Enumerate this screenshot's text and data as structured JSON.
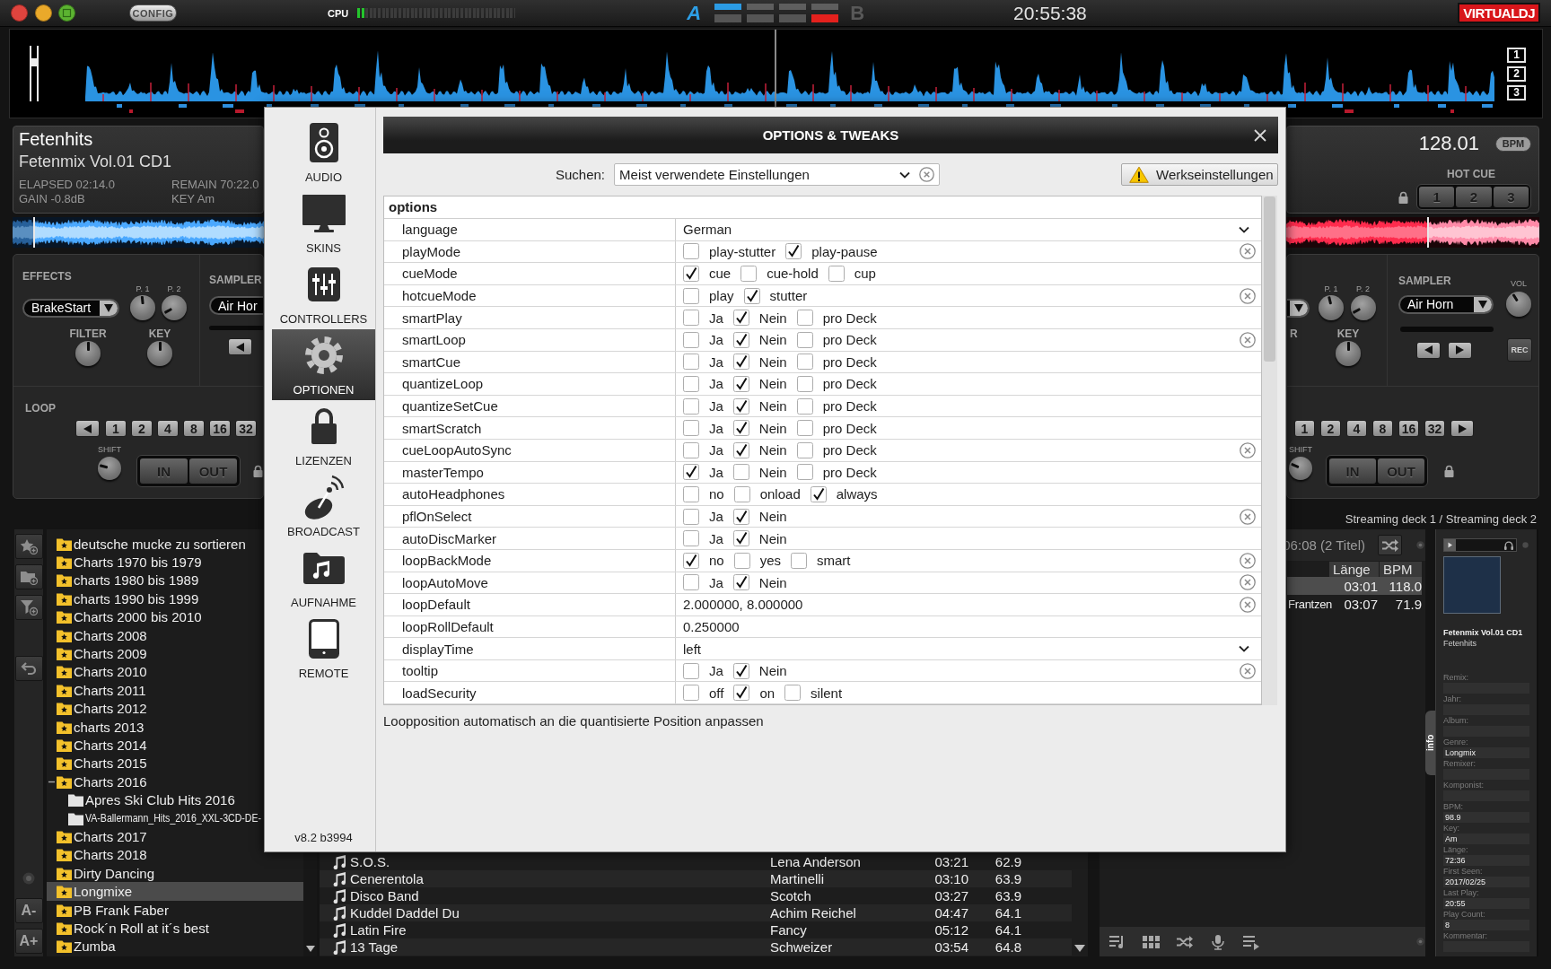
{
  "top_bar": {
    "config": "CONFIG",
    "cpu": {
      "label": "CPU",
      "level": 0.05
    },
    "deck_a": "A",
    "deck_slots": [
      {
        "top_on": true,
        "bottom_on": false,
        "color": "#2b9be4"
      },
      {
        "top_on": false,
        "bottom_on": false
      },
      {
        "top_on": false,
        "bottom_on": false
      },
      {
        "top_on": false,
        "bottom_on": true,
        "color": "#e3211d"
      }
    ],
    "deck_b": "B",
    "clock": "20:55:38",
    "logo": "VIRTUALDJ"
  },
  "overview": {
    "zoom_buttons": [
      "1",
      "2",
      "3"
    ]
  },
  "left_deck": {
    "title": "Fetenhits",
    "album": "Fetenmix Vol.01 CD1",
    "elapsed": "ELAPSED 02:14.0",
    "remain": "REMAIN 70:22.0",
    "gain": "GAIN -0.8dB",
    "key": "KEY Am",
    "effects": {
      "label": "EFFECTS",
      "effect": "BrakeStart",
      "knobs": [
        {
          "label": "P. 1",
          "level": 0.48
        },
        {
          "label": "P. 2",
          "level": 0.06
        }
      ]
    },
    "filter": {
      "label": "FILTER",
      "level": 0.5
    },
    "key_knob": {
      "label": "KEY",
      "level": 0.5
    },
    "sampler": {
      "label": "SAMPLER",
      "sample": "Air Hor"
    },
    "loop": {
      "label": "LOOP",
      "sizes": [
        "1",
        "2",
        "4",
        "8",
        "16",
        "32"
      ],
      "shift": {
        "label": "SHIFT",
        "level": 0.22
      },
      "in": "IN",
      "out": "OUT"
    }
  },
  "right_deck": {
    "bpm": "128.01",
    "bpm_unit": "BPM",
    "hot_cue": {
      "label": "HOT CUE",
      "buttons": [
        "1",
        "2",
        "3"
      ]
    },
    "effects": {
      "knobs": [
        {
          "label": "P. 1",
          "level": 0.45
        },
        {
          "label": "P. 2",
          "level": 0.06
        }
      ]
    },
    "filter": {
      "label": "R"
    },
    "key_knob": {
      "label": "KEY",
      "level": 0.5
    },
    "sampler": {
      "label": "SAMPLER",
      "sample": "Air Horn",
      "volume": {
        "label": "VOL",
        "level": 0.38
      },
      "rec": "REC"
    },
    "loop": {
      "sizes": [
        "1",
        "2",
        "4",
        "8",
        "16",
        "32"
      ],
      "shift": {
        "label": "SHIFT",
        "level": 0.25
      },
      "in": "IN",
      "out": "OUT"
    }
  },
  "streaming": "Streaming deck 1 / Streaming deck 2",
  "browser": {
    "toolbar": [
      "A-",
      "A+"
    ],
    "folders": [
      {
        "name": "deutsche mucke zu sortieren",
        "kind": "favorite",
        "selected": false
      },
      {
        "name": "Charts 1970 bis 1979",
        "kind": "favorite",
        "selected": false
      },
      {
        "name": "charts 1980 bis 1989",
        "kind": "favorite",
        "selected": false
      },
      {
        "name": "charts 1990 bis 1999",
        "kind": "favorite",
        "selected": false
      },
      {
        "name": "Charts 2000 bis 2010",
        "kind": "favorite",
        "selected": false
      },
      {
        "name": "Charts 2008",
        "kind": "favorite",
        "selected": false
      },
      {
        "name": "Charts 2009",
        "kind": "favorite",
        "selected": false
      },
      {
        "name": "Charts 2010",
        "kind": "favorite",
        "selected": false
      },
      {
        "name": "Charts 2011",
        "kind": "favorite",
        "selected": false
      },
      {
        "name": "Charts 2012",
        "kind": "favorite",
        "selected": false
      },
      {
        "name": "charts 2013",
        "kind": "favorite",
        "selected": false
      },
      {
        "name": "Charts 2014",
        "kind": "favorite",
        "selected": false
      },
      {
        "name": "Charts 2015",
        "kind": "favorite",
        "selected": false
      },
      {
        "name": "Charts 2016",
        "kind": "favorite",
        "selected": false,
        "expanded": true,
        "children": [
          {
            "name": "Apres Ski Club Hits 2016",
            "kind": "folder",
            "selected": false
          },
          {
            "name": "VA-Ballermann_Hits_2016_XXL-3CD-DE-",
            "kind": "folder",
            "selected": false
          }
        ]
      },
      {
        "name": "Charts 2017",
        "kind": "favorite",
        "selected": false
      },
      {
        "name": "Charts 2018",
        "kind": "favorite",
        "selected": false
      },
      {
        "name": "Dirty Dancing",
        "kind": "favorite",
        "selected": false
      },
      {
        "name": "Longmixe",
        "kind": "favorite",
        "selected": true
      },
      {
        "name": "PB Frank Faber",
        "kind": "favorite",
        "selected": false
      },
      {
        "name": "Rock´n Roll at it´s best",
        "kind": "favorite",
        "selected": false
      },
      {
        "name": "Zumba",
        "kind": "favorite",
        "selected": false
      }
    ],
    "tracks": [
      {
        "title": "S.O.S.",
        "artist": "Lena Anderson",
        "length": "03:21",
        "bpm": "62.9"
      },
      {
        "title": "Cenerentola",
        "artist": "Martinelli",
        "length": "03:10",
        "bpm": "63.9"
      },
      {
        "title": "Disco Band",
        "artist": "Scotch",
        "length": "03:27",
        "bpm": "63.9"
      },
      {
        "title": "Kuddel Daddel Du",
        "artist": "Achim Reichel",
        "length": "04:47",
        "bpm": "64.1"
      },
      {
        "title": "Latin Fire",
        "artist": "Fancy",
        "length": "05:12",
        "bpm": "64.1"
      },
      {
        "title": "13 Tage",
        "artist": "Schweizer",
        "length": "03:54",
        "bpm": "64.8"
      }
    ],
    "sideview": {
      "summary": "06:08 (2 Titel)",
      "columns": [
        "Länge",
        "BPM"
      ],
      "rows": [
        {
          "length": "03:01",
          "bpm": "118.0",
          "selected": true
        },
        {
          "artist": "Frantzen",
          "length": "03:07",
          "bpm": "71.9",
          "selected": false
        }
      ]
    },
    "info": {
      "tab": "info",
      "title": "Fetenmix Vol.01 CD1",
      "artist": "Fetenhits",
      "fields": [
        {
          "label": "Remix:"
        },
        {
          "label": "Jahr:"
        },
        {
          "label": "Album:"
        },
        {
          "label": "Genre:",
          "value": "Longmix"
        },
        {
          "label": "Remixer:"
        },
        {
          "label": "Komponist:"
        },
        {
          "label": "BPM:",
          "value": "98.9"
        },
        {
          "label": "Key:",
          "value": "Am"
        },
        {
          "label": "Länge:",
          "value": "72:36"
        },
        {
          "label": "First Seen:",
          "value": "2017/02/25"
        },
        {
          "label": "Last Play:",
          "value": "20:55"
        },
        {
          "label": "Play Count:",
          "value": "8"
        },
        {
          "label": "Kommentar:"
        }
      ]
    }
  },
  "dialog": {
    "title": "OPTIONS & TWEAKS",
    "sidebar": [
      {
        "label": "AUDIO",
        "selected": false
      },
      {
        "label": "SKINS",
        "selected": false
      },
      {
        "label": "CONTROLLERS",
        "selected": false
      },
      {
        "label": "OPTIONEN",
        "selected": true
      },
      {
        "label": "LIZENZEN",
        "selected": false
      },
      {
        "label": "BROADCAST",
        "selected": false
      },
      {
        "label": "AUFNAHME",
        "selected": false
      },
      {
        "label": "REMOTE",
        "selected": false
      }
    ],
    "version": "v8.2 b3994",
    "search": {
      "label": "Suchen:",
      "value": "Meist verwendete Einstellungen"
    },
    "factory_reset": "Werkseinstellungen",
    "table": {
      "section": "options",
      "rows": [
        {
          "name": "language",
          "kind": "dropdown",
          "value": "German",
          "modified": false
        },
        {
          "name": "playMode",
          "kind": "checks",
          "options": [
            {
              "label": "play-stutter",
              "checked": false
            },
            {
              "label": "play-pause",
              "checked": true
            }
          ],
          "modified": true
        },
        {
          "name": "cueMode",
          "kind": "checks",
          "options": [
            {
              "label": "cue",
              "checked": true
            },
            {
              "label": "cue-hold",
              "checked": false
            },
            {
              "label": "cup",
              "checked": false
            }
          ],
          "modified": false
        },
        {
          "name": "hotcueMode",
          "kind": "checks",
          "options": [
            {
              "label": "play",
              "checked": false
            },
            {
              "label": "stutter",
              "checked": true
            }
          ],
          "modified": true
        },
        {
          "name": "smartPlay",
          "kind": "checks",
          "options": [
            {
              "label": "Ja",
              "checked": false
            },
            {
              "label": "Nein",
              "checked": true
            },
            {
              "label": "pro Deck",
              "checked": false
            }
          ],
          "modified": false
        },
        {
          "name": "smartLoop",
          "kind": "checks",
          "options": [
            {
              "label": "Ja",
              "checked": false
            },
            {
              "label": "Nein",
              "checked": true
            },
            {
              "label": "pro Deck",
              "checked": false
            }
          ],
          "modified": true
        },
        {
          "name": "smartCue",
          "kind": "checks",
          "options": [
            {
              "label": "Ja",
              "checked": false
            },
            {
              "label": "Nein",
              "checked": true
            },
            {
              "label": "pro Deck",
              "checked": false
            }
          ],
          "modified": false
        },
        {
          "name": "quantizeLoop",
          "kind": "checks",
          "options": [
            {
              "label": "Ja",
              "checked": false
            },
            {
              "label": "Nein",
              "checked": true
            },
            {
              "label": "pro Deck",
              "checked": false
            }
          ],
          "modified": false
        },
        {
          "name": "quantizeSetCue",
          "kind": "checks",
          "options": [
            {
              "label": "Ja",
              "checked": false
            },
            {
              "label": "Nein",
              "checked": true
            },
            {
              "label": "pro Deck",
              "checked": false
            }
          ],
          "modified": false
        },
        {
          "name": "smartScratch",
          "kind": "checks",
          "options": [
            {
              "label": "Ja",
              "checked": false
            },
            {
              "label": "Nein",
              "checked": true
            },
            {
              "label": "pro Deck",
              "checked": false
            }
          ],
          "modified": false
        },
        {
          "name": "cueLoopAutoSync",
          "kind": "checks",
          "options": [
            {
              "label": "Ja",
              "checked": false
            },
            {
              "label": "Nein",
              "checked": true
            },
            {
              "label": "pro Deck",
              "checked": false
            }
          ],
          "modified": true
        },
        {
          "name": "masterTempo",
          "kind": "checks",
          "options": [
            {
              "label": "Ja",
              "checked": true
            },
            {
              "label": "Nein",
              "checked": false
            },
            {
              "label": "pro Deck",
              "checked": false
            }
          ],
          "modified": false
        },
        {
          "name": "autoHeadphones",
          "kind": "checks",
          "options": [
            {
              "label": "no",
              "checked": false
            },
            {
              "label": "onload",
              "checked": false
            },
            {
              "label": "always",
              "checked": true
            }
          ],
          "modified": false
        },
        {
          "name": "pflOnSelect",
          "kind": "checks",
          "options": [
            {
              "label": "Ja",
              "checked": false
            },
            {
              "label": "Nein",
              "checked": true
            }
          ],
          "modified": true
        },
        {
          "name": "autoDiscMarker",
          "kind": "checks",
          "options": [
            {
              "label": "Ja",
              "checked": false
            },
            {
              "label": "Nein",
              "checked": true
            }
          ],
          "modified": false
        },
        {
          "name": "loopBackMode",
          "kind": "checks",
          "options": [
            {
              "label": "no",
              "checked": true
            },
            {
              "label": "yes",
              "checked": false
            },
            {
              "label": "smart",
              "checked": false
            }
          ],
          "modified": true
        },
        {
          "name": "loopAutoMove",
          "kind": "checks",
          "options": [
            {
              "label": "Ja",
              "checked": false
            },
            {
              "label": "Nein",
              "checked": true
            }
          ],
          "modified": true
        },
        {
          "name": "loopDefault",
          "kind": "text",
          "value": "2.000000, 8.000000",
          "modified": true
        },
        {
          "name": "loopRollDefault",
          "kind": "text",
          "value": "0.250000",
          "modified": false
        },
        {
          "name": "displayTime",
          "kind": "dropdown",
          "value": "left",
          "modified": false
        },
        {
          "name": "tooltip",
          "kind": "checks",
          "options": [
            {
              "label": "Ja",
              "checked": false
            },
            {
              "label": "Nein",
              "checked": true
            }
          ],
          "modified": true
        },
        {
          "name": "loadSecurity",
          "kind": "checks",
          "options": [
            {
              "label": "off",
              "checked": false
            },
            {
              "label": "on",
              "checked": true
            },
            {
              "label": "silent",
              "checked": false
            }
          ],
          "modified": false
        }
      ]
    },
    "description": "Loopposition automatisch an die quantisierte Position anpassen"
  }
}
